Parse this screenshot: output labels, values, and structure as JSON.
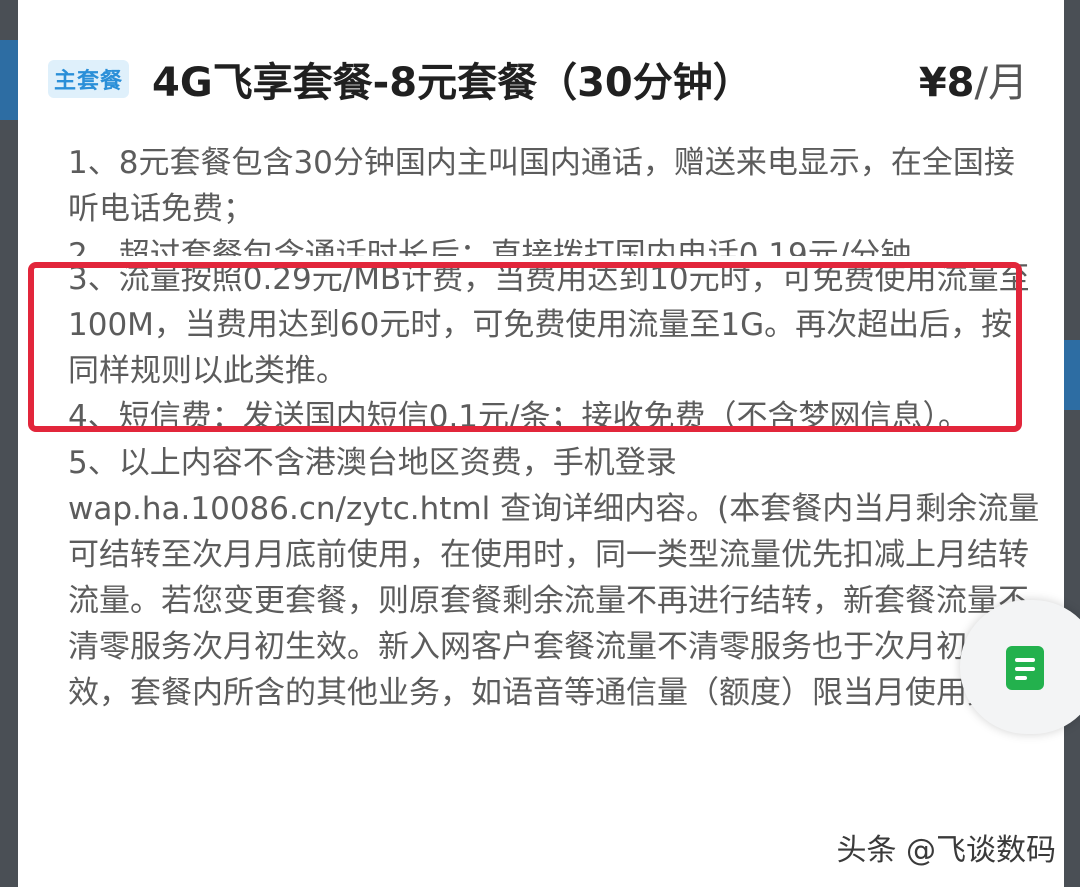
{
  "package": {
    "badge": "主套餐",
    "title": "4G飞享套餐-8元套餐（30分钟）",
    "price_amount": "¥8",
    "price_unit": "/月"
  },
  "terms": [
    "1、8元套餐包含30分钟国内主叫国内通话，赠送来电显示，在全国接听电话免费；",
    "2、超过套餐包含通话时长后：直接拨打国内电话0.19元/分钟。",
    "3、流量按照0.29元/MB计费，当费用达到10元时，可免费使用流量至100M，当费用达到60元时，可免费使用流量至1G。再次超出后，按同样规则以此类推。",
    "4、短信费：发送国内短信0.1元/条；接收免费（不含梦网信息）。",
    "5、以上内容不含港澳台地区资费，手机登录wap.ha.10086.cn/zytc.html 查询详细内容。(本套餐内当月剩余流量可结转至次月月底前使用，在使用时，同一类型流量优先扣减上月结转流量。若您变更套餐，则原套餐剩余流量不再进行结转，新套餐流量不清零服务次月初生效。新入网客户套餐流量不清零服务也于次月初生效，套餐内所含的其他业务，如语音等通信量（额度）限当月使用完毕)"
  ],
  "watermark": "头条 @飞谈数码",
  "colors": {
    "badge_bg": "#dff0fb",
    "badge_text": "#2a8fd8",
    "highlight_border": "#e2263b",
    "floating_icon": "#23b14d"
  },
  "floating_button_icon": "document-icon"
}
